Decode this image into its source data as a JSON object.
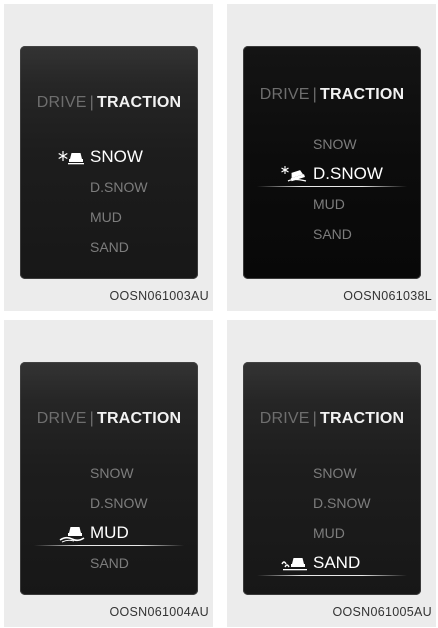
{
  "panels": [
    {
      "header": {
        "drive": "DRIVE",
        "sep": "|",
        "traction": "TRACTION"
      },
      "modes": [
        "SNOW",
        "D.SNOW",
        "MUD",
        "SAND"
      ],
      "active": "SNOW",
      "active_icon": "snowflake-car-icon",
      "caption": "OOSN061003AU"
    },
    {
      "header": {
        "drive": "DRIVE",
        "sep": "|",
        "traction": "TRACTION"
      },
      "modes": [
        "SNOW",
        "D.SNOW",
        "MUD",
        "SAND"
      ],
      "active": "D.SNOW",
      "active_icon": "deep-snow-car-icon",
      "caption": "OOSN061038L"
    },
    {
      "header": {
        "drive": "DRIVE",
        "sep": "|",
        "traction": "TRACTION"
      },
      "modes": [
        "SNOW",
        "D.SNOW",
        "MUD",
        "SAND"
      ],
      "active": "MUD",
      "active_icon": "mud-car-icon",
      "caption": "OOSN061004AU"
    },
    {
      "header": {
        "drive": "DRIVE",
        "sep": "|",
        "traction": "TRACTION"
      },
      "modes": [
        "SNOW",
        "D.SNOW",
        "MUD",
        "SAND"
      ],
      "active": "SAND",
      "active_icon": "sand-car-icon",
      "caption": "OOSN061005AU"
    }
  ]
}
